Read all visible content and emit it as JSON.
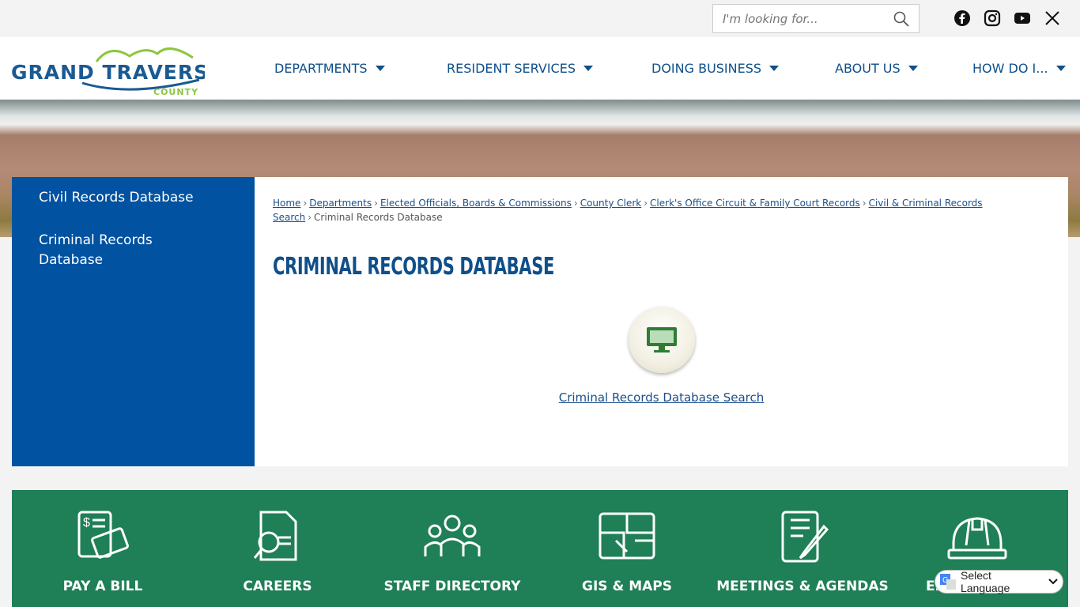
{
  "search": {
    "placeholder": "I'm looking for..."
  },
  "social": [
    "facebook-icon",
    "instagram-icon",
    "youtube-icon",
    "x-icon"
  ],
  "logo": {
    "line1": "GRAND TRAVERSE",
    "line2": "COUNTY"
  },
  "nav": [
    "DEPARTMENTS",
    "RESIDENT SERVICES",
    "DOING BUSINESS",
    "ABOUT US",
    "HOW DO I..."
  ],
  "sidebar": [
    "Civil Records Database",
    "Criminal Records Database"
  ],
  "breadcrumb": {
    "links": [
      "Home",
      "Departments",
      "Elected Officials, Boards & Commissions",
      "County Clerk",
      "Clerk's Office Circuit & Family Court Records",
      "Civil & Criminal Records Search"
    ],
    "current": "Criminal Records Database"
  },
  "page_title": "CRIMINAL RECORDS DATABASE",
  "graphic_link": "Criminal Records Database Search",
  "quick_links": [
    "PAY A BILL",
    "CAREERS",
    "STAFF DIRECTORY",
    "GIS & MAPS",
    "MEETINGS & AGENDAS",
    "EPERMITTING"
  ],
  "language": "Select Language",
  "colors": {
    "brand_blue": "#0152a0",
    "nav_text": "#0f4f8a",
    "quick_green": "#1f7f56",
    "logo_green": "#8dc63f"
  }
}
